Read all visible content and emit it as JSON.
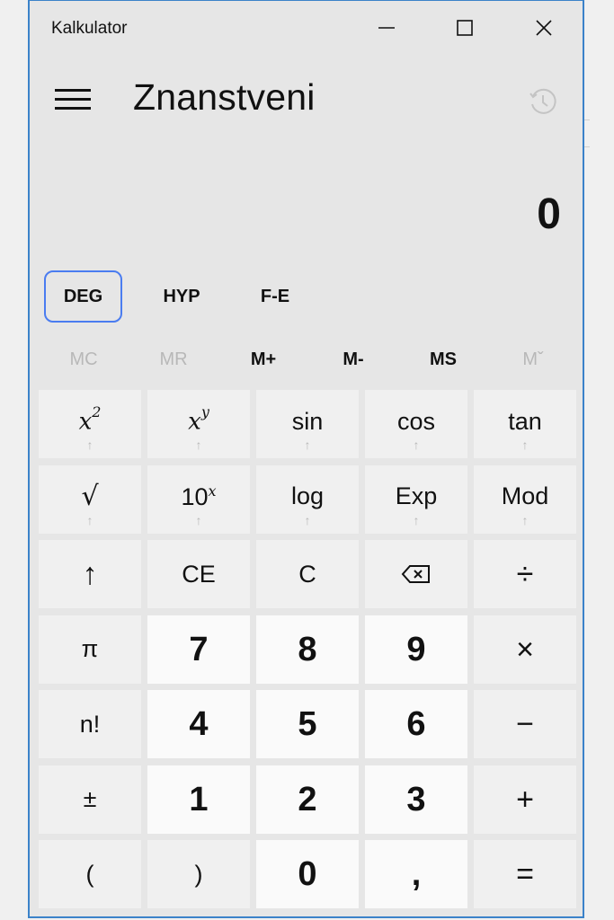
{
  "window": {
    "title": "Kalkulator",
    "controls": {
      "minimize": "minimize-icon",
      "maximize": "maximize-icon",
      "close": "close-icon"
    }
  },
  "header": {
    "menu_icon": "hamburger-icon",
    "mode": "Znanstveni",
    "history_icon": "history-icon"
  },
  "display": {
    "value": "0"
  },
  "angle_row": [
    {
      "label": "DEG",
      "focused": true
    },
    {
      "label": "HYP"
    },
    {
      "label": "F-E"
    }
  ],
  "memory": [
    {
      "label": "MC",
      "enabled": false
    },
    {
      "label": "MR",
      "enabled": false
    },
    {
      "label": "M+",
      "enabled": true
    },
    {
      "label": "M-",
      "enabled": true
    },
    {
      "label": "MS",
      "enabled": true
    },
    {
      "label": "Mˇ",
      "enabled": false
    }
  ],
  "keys": {
    "x2": {
      "base": "x",
      "sup": "2",
      "shift": "↑"
    },
    "xy": {
      "base": "x",
      "sup": "y",
      "shift": "↑"
    },
    "sin": {
      "label": "sin",
      "shift": "↑"
    },
    "cos": {
      "label": "cos",
      "shift": "↑"
    },
    "tan": {
      "label": "tan",
      "shift": "↑"
    },
    "sqrt": {
      "label": "√",
      "shift": "↑"
    },
    "ten_x": {
      "base": "10",
      "sup": "x",
      "shift": "↑"
    },
    "log": {
      "label": "log",
      "shift": "↑"
    },
    "exp": {
      "label": "Exp",
      "shift": "↑"
    },
    "mod": {
      "label": "Mod",
      "shift": "↑"
    },
    "shift": {
      "label": "↑"
    },
    "ce": {
      "label": "CE"
    },
    "c": {
      "label": "C"
    },
    "backspace": {
      "icon": "backspace-icon"
    },
    "divide": {
      "label": "÷"
    },
    "pi": {
      "label": "π"
    },
    "d7": {
      "label": "7"
    },
    "d8": {
      "label": "8"
    },
    "d9": {
      "label": "9"
    },
    "multiply": {
      "label": "×"
    },
    "fact": {
      "label": "n!"
    },
    "d4": {
      "label": "4"
    },
    "d5": {
      "label": "5"
    },
    "d6": {
      "label": "6"
    },
    "minus": {
      "label": "−"
    },
    "negate": {
      "label": "±"
    },
    "d1": {
      "label": "1"
    },
    "d2": {
      "label": "2"
    },
    "d3": {
      "label": "3"
    },
    "plus": {
      "label": "+"
    },
    "lparen": {
      "label": "("
    },
    "rparen": {
      "label": ")"
    },
    "d0": {
      "label": "0"
    },
    "decimal": {
      "label": ","
    },
    "equals": {
      "label": "="
    }
  },
  "colors": {
    "accent_border": "#3b82c9",
    "focus_ring": "#4a7cf0",
    "window_bg": "#e6e6e6",
    "function_key": "#f0f0f0",
    "number_key": "#fafafa",
    "disabled_text": "#b8b8b8"
  }
}
